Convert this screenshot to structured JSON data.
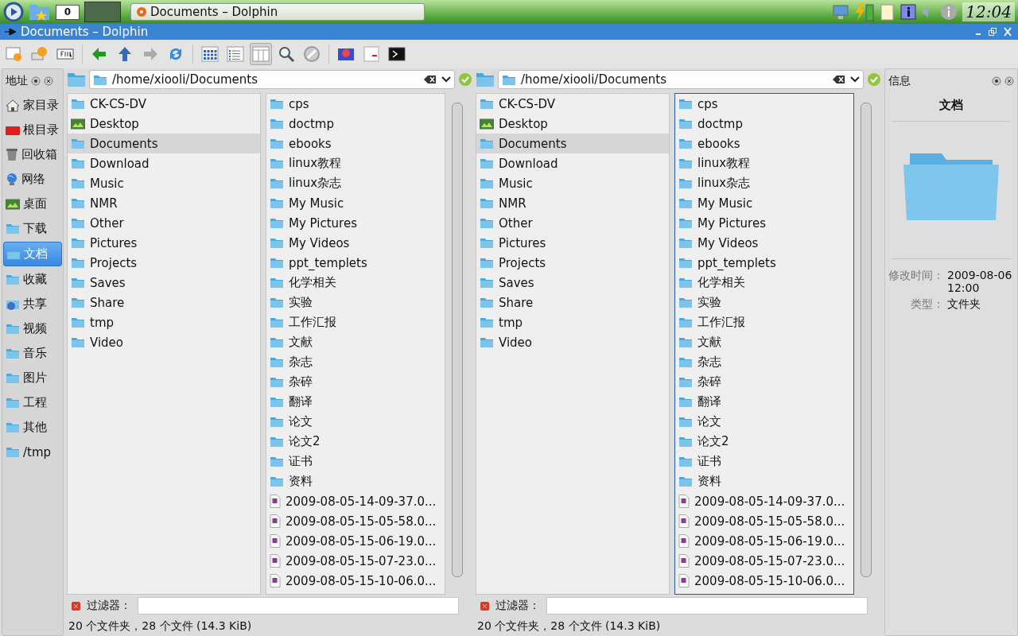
{
  "taskbar": {
    "mail_count": "0",
    "task_title": "Documents – Dolphin",
    "clock": "12:04"
  },
  "window": {
    "title": "Documents – Dolphin"
  },
  "toolbar": {
    "navigation": [
      {
        "kind": "back",
        "disabled": false
      },
      {
        "kind": "up",
        "disabled": false
      },
      {
        "kind": "forward",
        "disabled": true
      },
      {
        "kind": "reload",
        "disabled": false
      }
    ],
    "view_modes": [
      {
        "kind": "icons",
        "selected": false
      },
      {
        "kind": "details",
        "selected": false
      },
      {
        "kind": "columns",
        "selected": true
      }
    ]
  },
  "places": {
    "title": "地址",
    "items": [
      {
        "label": "家目录",
        "kind": "home",
        "selected": false
      },
      {
        "label": "根目录",
        "kind": "root",
        "selected": false
      },
      {
        "label": "回收箱",
        "kind": "trash",
        "selected": false
      },
      {
        "label": "网络",
        "kind": "network",
        "selected": false
      },
      {
        "label": "桌面",
        "kind": "desktop",
        "selected": false
      },
      {
        "label": "下载",
        "kind": "folder",
        "selected": false
      },
      {
        "label": "文档",
        "kind": "folder",
        "selected": true
      },
      {
        "label": "收藏",
        "kind": "folder",
        "selected": false
      },
      {
        "label": "共享",
        "kind": "share",
        "selected": false
      },
      {
        "label": "视频",
        "kind": "folder",
        "selected": false
      },
      {
        "label": "音乐",
        "kind": "folder",
        "selected": false
      },
      {
        "label": "图片",
        "kind": "folder",
        "selected": false
      },
      {
        "label": "工程",
        "kind": "folder",
        "selected": false
      },
      {
        "label": "其他",
        "kind": "folder",
        "selected": false
      },
      {
        "label": "/tmp",
        "kind": "folder",
        "selected": false
      }
    ]
  },
  "panes": [
    {
      "path": "/home/xiooli/Documents",
      "filter_label": "过滤器：",
      "status": "20 个文件夹，28 个文件 (14.3 KiB)",
      "columns": [
        {
          "focused": false,
          "items": [
            {
              "name": "CK-CS-DV",
              "kind": "folder",
              "selected": false
            },
            {
              "name": "Desktop",
              "kind": "desktop",
              "selected": false
            },
            {
              "name": "Documents",
              "kind": "folder",
              "selected": true
            },
            {
              "name": "Download",
              "kind": "folder",
              "selected": false
            },
            {
              "name": "Music",
              "kind": "folder",
              "selected": false
            },
            {
              "name": "NMR",
              "kind": "folder",
              "selected": false
            },
            {
              "name": "Other",
              "kind": "folder",
              "selected": false
            },
            {
              "name": "Pictures",
              "kind": "folder",
              "selected": false
            },
            {
              "name": "Projects",
              "kind": "folder",
              "selected": false
            },
            {
              "name": "Saves",
              "kind": "folder",
              "selected": false
            },
            {
              "name": "Share",
              "kind": "folder",
              "selected": false
            },
            {
              "name": "tmp",
              "kind": "folder",
              "selected": false
            },
            {
              "name": "Video",
              "kind": "folder",
              "selected": false
            }
          ]
        },
        {
          "focused": false,
          "items": [
            {
              "name": "cps",
              "kind": "folder",
              "selected": false
            },
            {
              "name": "doctmp",
              "kind": "folder",
              "selected": false
            },
            {
              "name": "ebooks",
              "kind": "folder",
              "selected": false
            },
            {
              "name": "linux教程",
              "kind": "folder",
              "selected": false
            },
            {
              "name": "linux杂志",
              "kind": "folder",
              "selected": false
            },
            {
              "name": "My Music",
              "kind": "folder",
              "selected": false
            },
            {
              "name": "My Pictures",
              "kind": "folder",
              "selected": false
            },
            {
              "name": "My Videos",
              "kind": "folder",
              "selected": false
            },
            {
              "name": "ppt_templets",
              "kind": "folder",
              "selected": false
            },
            {
              "name": "化学相关",
              "kind": "folder",
              "selected": false
            },
            {
              "name": "实验",
              "kind": "folder",
              "selected": false
            },
            {
              "name": "工作汇报",
              "kind": "folder",
              "selected": false
            },
            {
              "name": "文献",
              "kind": "folder",
              "selected": false
            },
            {
              "name": "杂志",
              "kind": "folder",
              "selected": false
            },
            {
              "name": "杂碎",
              "kind": "folder",
              "selected": false
            },
            {
              "name": "翻译",
              "kind": "folder",
              "selected": false
            },
            {
              "name": "论文",
              "kind": "folder",
              "selected": false
            },
            {
              "name": "论文2",
              "kind": "folder",
              "selected": false
            },
            {
              "name": "证书",
              "kind": "folder",
              "selected": false
            },
            {
              "name": "资料",
              "kind": "folder",
              "selected": false
            },
            {
              "name": "2009-08-05-14-09-37.0...",
              "kind": "file",
              "selected": false
            },
            {
              "name": "2009-08-05-15-05-58.0...",
              "kind": "file",
              "selected": false
            },
            {
              "name": "2009-08-05-15-06-19.0...",
              "kind": "file",
              "selected": false
            },
            {
              "name": "2009-08-05-15-07-23.0...",
              "kind": "file",
              "selected": false
            },
            {
              "name": "2009-08-05-15-10-06.0...",
              "kind": "file",
              "selected": false
            }
          ]
        }
      ]
    },
    {
      "path": "/home/xiooli/Documents",
      "filter_label": "过滤器：",
      "status": "20 个文件夹，28 个文件 (14.3 KiB)",
      "columns": [
        {
          "focused": false,
          "items": [
            {
              "name": "CK-CS-DV",
              "kind": "folder",
              "selected": false
            },
            {
              "name": "Desktop",
              "kind": "desktop",
              "selected": false
            },
            {
              "name": "Documents",
              "kind": "folder",
              "selected": true
            },
            {
              "name": "Download",
              "kind": "folder",
              "selected": false
            },
            {
              "name": "Music",
              "kind": "folder",
              "selected": false
            },
            {
              "name": "NMR",
              "kind": "folder",
              "selected": false
            },
            {
              "name": "Other",
              "kind": "folder",
              "selected": false
            },
            {
              "name": "Pictures",
              "kind": "folder",
              "selected": false
            },
            {
              "name": "Projects",
              "kind": "folder",
              "selected": false
            },
            {
              "name": "Saves",
              "kind": "folder",
              "selected": false
            },
            {
              "name": "Share",
              "kind": "folder",
              "selected": false
            },
            {
              "name": "tmp",
              "kind": "folder",
              "selected": false
            },
            {
              "name": "Video",
              "kind": "folder",
              "selected": false
            }
          ]
        },
        {
          "focused": true,
          "items": [
            {
              "name": "cps",
              "kind": "folder",
              "selected": false
            },
            {
              "name": "doctmp",
              "kind": "folder",
              "selected": false
            },
            {
              "name": "ebooks",
              "kind": "folder",
              "selected": false
            },
            {
              "name": "linux教程",
              "kind": "folder",
              "selected": false
            },
            {
              "name": "linux杂志",
              "kind": "folder",
              "selected": false
            },
            {
              "name": "My Music",
              "kind": "folder",
              "selected": false
            },
            {
              "name": "My Pictures",
              "kind": "folder",
              "selected": false
            },
            {
              "name": "My Videos",
              "kind": "folder",
              "selected": false
            },
            {
              "name": "ppt_templets",
              "kind": "folder",
              "selected": false
            },
            {
              "name": "化学相关",
              "kind": "folder",
              "selected": false
            },
            {
              "name": "实验",
              "kind": "folder",
              "selected": false
            },
            {
              "name": "工作汇报",
              "kind": "folder",
              "selected": false
            },
            {
              "name": "文献",
              "kind": "folder",
              "selected": false
            },
            {
              "name": "杂志",
              "kind": "folder",
              "selected": false
            },
            {
              "name": "杂碎",
              "kind": "folder",
              "selected": false
            },
            {
              "name": "翻译",
              "kind": "folder",
              "selected": false
            },
            {
              "name": "论文",
              "kind": "folder",
              "selected": false
            },
            {
              "name": "论文2",
              "kind": "folder",
              "selected": false
            },
            {
              "name": "证书",
              "kind": "folder",
              "selected": false
            },
            {
              "name": "资料",
              "kind": "folder",
              "selected": false
            },
            {
              "name": "2009-08-05-14-09-37.0...",
              "kind": "file",
              "selected": false
            },
            {
              "name": "2009-08-05-15-05-58.0...",
              "kind": "file",
              "selected": false
            },
            {
              "name": "2009-08-05-15-06-19.0...",
              "kind": "file",
              "selected": false
            },
            {
              "name": "2009-08-05-15-07-23.0...",
              "kind": "file",
              "selected": false
            },
            {
              "name": "2009-08-05-15-10-06.0...",
              "kind": "file",
              "selected": false
            }
          ]
        }
      ]
    }
  ],
  "info": {
    "title": "信息",
    "name": "文档",
    "fields": [
      {
        "label": "修改时间：",
        "value": "2009-08-06 12:00"
      },
      {
        "label": "类型：",
        "value": "文件夹"
      }
    ]
  }
}
